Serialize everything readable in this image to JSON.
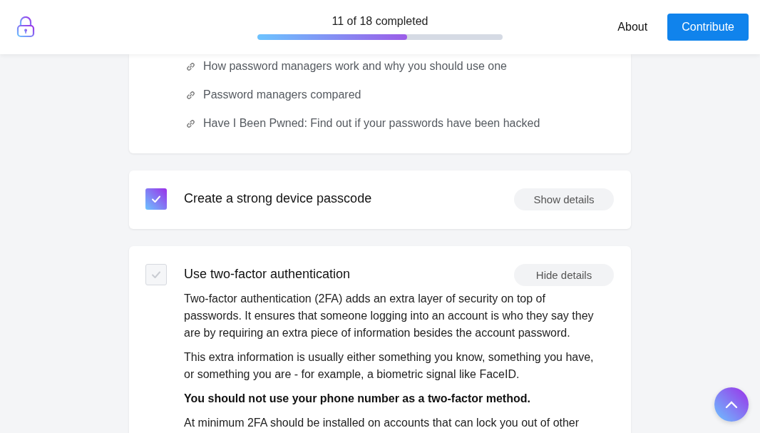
{
  "header": {
    "progress_text": "11 of 18 completed",
    "progress": {
      "level": 0.611
    },
    "nav": [
      {
        "label": "About",
        "kind": "link"
      },
      {
        "label": "Contribute",
        "kind": "button"
      }
    ]
  },
  "resources": [
    "How password managers work and why you should use one",
    "Password managers compared",
    "Have I Been Pwned: Find out if your passwords have been hacked"
  ],
  "tasks": [
    {
      "title": "Create a strong device passcode",
      "checked": true,
      "toggle": "Show details"
    },
    {
      "title": "Use two-factor authentication",
      "checked": false,
      "toggle": "Hide details",
      "paragraphs": [
        {
          "kind": "text",
          "text": "Two-factor authentication (2FA) adds an extra layer of security on top of passwords. It ensures that someone logging into an account is who they say they are by requiring an extra piece of information besides the account password."
        },
        {
          "kind": "text",
          "text": "This extra information is usually either something you know, something you have, or something you are - for example, a biometric signal like FaceID."
        },
        {
          "kind": "bold",
          "text": "You should not use your phone number as a two-factor method."
        },
        {
          "kind": "text",
          "text": "At minimum 2FA should be installed on accounts that can lock you out of other"
        }
      ]
    }
  ]
}
